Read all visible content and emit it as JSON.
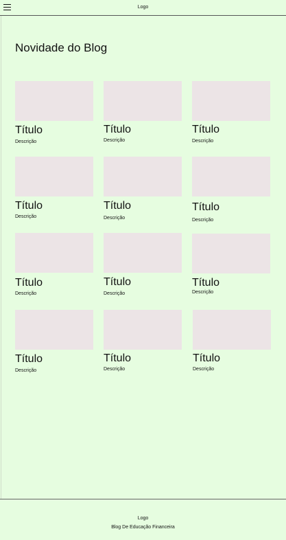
{
  "header": {
    "logo": "Logo"
  },
  "main": {
    "title": "Novidade do Blog",
    "posts": [
      {
        "title": "Título",
        "description": "Descrição"
      },
      {
        "title": "Título",
        "description": "Descrição"
      },
      {
        "title": "Título",
        "description": "Descrição"
      },
      {
        "title": "Título",
        "description": "Descrição"
      },
      {
        "title": "Título",
        "description": "Descrição"
      },
      {
        "title": "Título",
        "description": "Descrição"
      },
      {
        "title": "Título",
        "description": "Descrição"
      },
      {
        "title": "Título",
        "description": "Descrição"
      },
      {
        "title": "Título",
        "description": "Descrição"
      },
      {
        "title": "Título",
        "description": "Descrição"
      },
      {
        "title": "Título",
        "description": "Descrição"
      },
      {
        "title": "Título",
        "description": "Descrição"
      }
    ]
  },
  "footer": {
    "logo": "Logo",
    "text": "Blog De Educação Financeira"
  },
  "colors": {
    "background": "#e6fde0",
    "image_placeholder": "#ece4e6"
  },
  "icons": {
    "menu": "hamburger-menu-icon"
  }
}
